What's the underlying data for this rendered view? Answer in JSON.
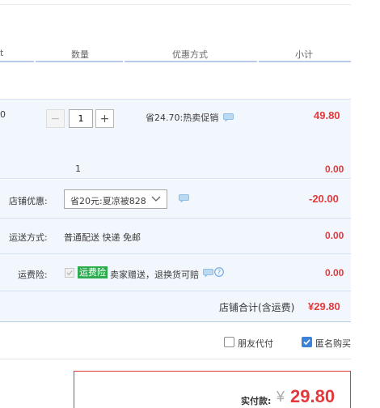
{
  "table_header": {
    "col_partial": "t",
    "quantity": "数量",
    "discount": "优惠方式",
    "subtotal": "小计"
  },
  "item": {
    "left_partial": "0",
    "qty_minus": "−",
    "qty_value": "1",
    "qty_plus": "+",
    "promo_text": "省24.70:热卖促销",
    "price": "49.80"
  },
  "gift_row": {
    "qty": "1",
    "price": "0.00"
  },
  "store_discount": {
    "label": "店铺优惠:",
    "select_value": "省20元:夏凉被828",
    "amount": "-20.00"
  },
  "shipping": {
    "label": "运送方式:",
    "value": "普通配送 快递 免邮",
    "amount": "0.00"
  },
  "insurance": {
    "label": "运费险:",
    "badge": "运费险",
    "text": "卖家赠送，退换货可赔",
    "amount": "0.00"
  },
  "store_total": {
    "label": "店铺合计(含运费)",
    "amount": "¥29.80"
  },
  "options": {
    "friend_pay": "朋友代付",
    "friend_pay_checked": false,
    "anonymous": "匿名购买",
    "anonymous_checked": true
  },
  "payment": {
    "label": "实付款:",
    "currency": "¥",
    "amount": "29.80"
  },
  "colors": {
    "accent_blue": "#3d82d6",
    "price_red": "#e4393c",
    "badge_green": "#2dab4f",
    "row_bg": "#f2f6fd"
  }
}
